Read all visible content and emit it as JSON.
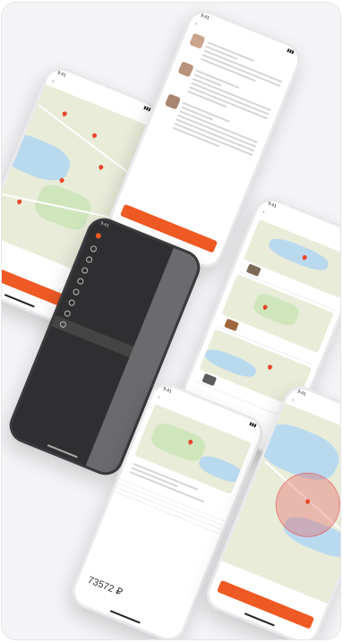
{
  "accent": "#ef5a24",
  "screen1": {
    "title": "",
    "action": ""
  },
  "screen2": {
    "title": "",
    "reviews": [
      {
        "name": "",
        "rating": ""
      },
      {
        "name": "",
        "rating": ""
      },
      {
        "name": "",
        "rating": ""
      }
    ],
    "action": ""
  },
  "screen3": {
    "brand": "",
    "menu": [
      "",
      "",
      "",
      "",
      "",
      "",
      "",
      ""
    ],
    "footer": ""
  },
  "screen4": {
    "title": "",
    "prices": [
      "",
      "",
      ""
    ]
  },
  "screen5": {
    "title": "",
    "rows": [
      {
        "label": "",
        "value": ""
      },
      {
        "label": "",
        "value": ""
      },
      {
        "label": "",
        "value": ""
      },
      {
        "label": "",
        "value": ""
      }
    ],
    "total": "73572 ₽"
  },
  "screen6": {
    "title": "",
    "action": ""
  }
}
